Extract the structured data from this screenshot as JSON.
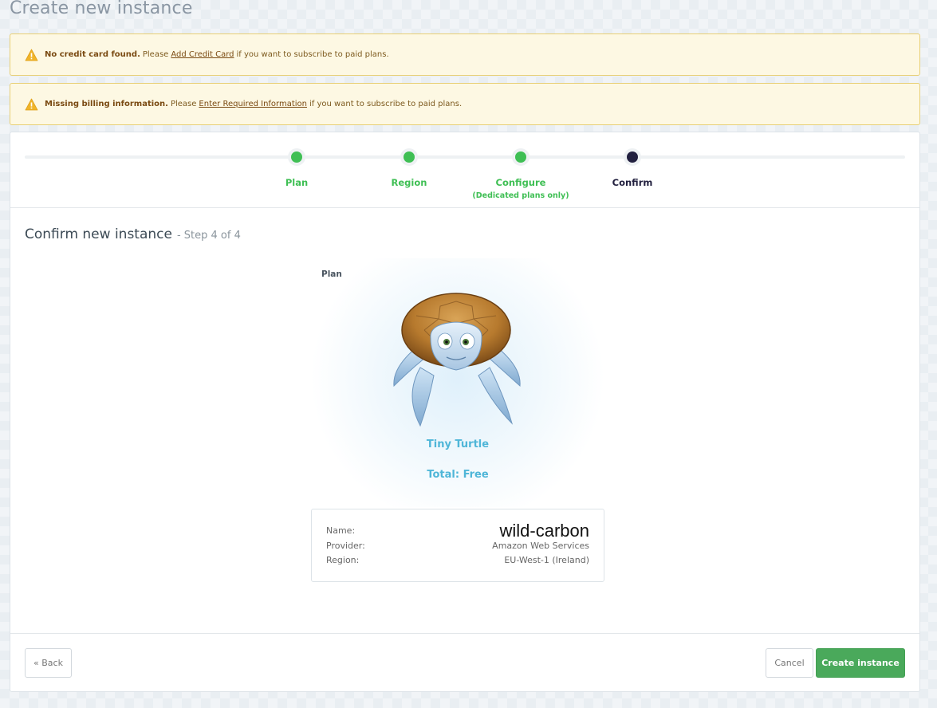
{
  "page": {
    "title": "Create new instance"
  },
  "alerts": [
    {
      "bold": "No credit card found.",
      "pre": "Please",
      "link": "Add Credit Card",
      "post": "if you want to subscribe to paid plans.",
      "icon": "warning-icon"
    },
    {
      "bold": "Missing billing information.",
      "pre": "Please",
      "link": "Enter Required Information",
      "post": "if you want to subscribe to paid plans.",
      "icon": "warning-icon"
    }
  ],
  "stepper": {
    "steps": [
      {
        "label": "Plan",
        "sublabel": "",
        "status": "complete"
      },
      {
        "label": "Region",
        "sublabel": "",
        "status": "complete"
      },
      {
        "label": "Configure",
        "sublabel": "(Dedicated plans only)",
        "status": "complete"
      },
      {
        "label": "Confirm",
        "sublabel": "",
        "status": "active"
      }
    ]
  },
  "confirm": {
    "title": "Confirm new instance",
    "step_text": "- Step 4 of 4",
    "plan_label": "Plan",
    "plan_name": "Tiny Turtle",
    "plan_total": "Total: Free",
    "details": {
      "name_label": "Name:",
      "name_value": "wild-carbon",
      "provider_label": "Provider:",
      "provider_value": "Amazon Web Services",
      "region_label": "Region:",
      "region_value": "EU-West-1 (Ireland)"
    }
  },
  "footer": {
    "back_label": "« Back",
    "cancel_label": "Cancel",
    "create_label": "Create instance"
  },
  "colors": {
    "step_complete": "#3fbf54",
    "step_active": "#22203f",
    "plan_text": "#4fb6d8",
    "create_button": "#4aa95b",
    "alert_bg": "#fdf8e3",
    "alert_border": "#e8cf74"
  }
}
